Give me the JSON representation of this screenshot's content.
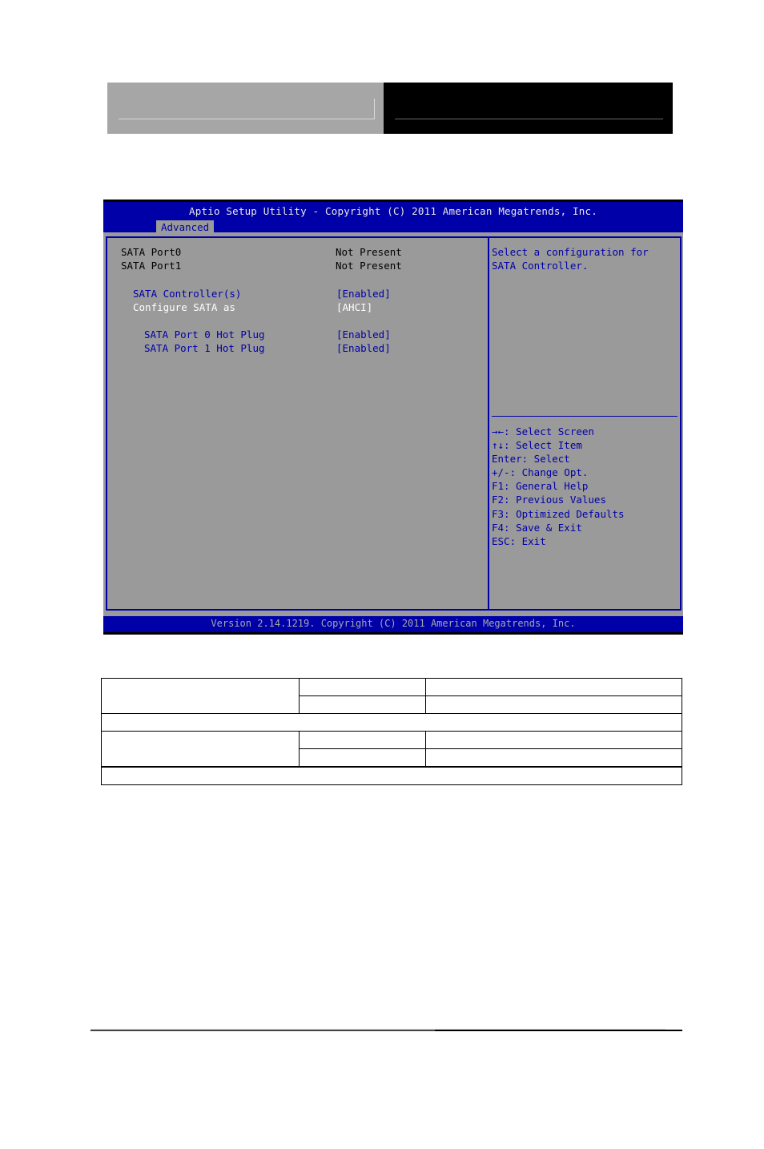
{
  "bios": {
    "title": "Aptio Setup Utility - Copyright (C) 2011 American Megatrends, Inc.",
    "active_tab": "Advanced",
    "footer": "Version 2.14.1219. Copyright (C) 2011 American Megatrends, Inc.",
    "items": [
      {
        "label": "SATA Port0",
        "value": "Not Present"
      },
      {
        "label": "SATA Port1",
        "value": "Not Present"
      },
      {
        "label": "SATA Controller(s)",
        "value": "[Enabled]"
      },
      {
        "label": "Configure SATA as",
        "value": "[AHCI]"
      },
      {
        "label": "SATA Port 0 Hot Plug",
        "value": "[Enabled]"
      },
      {
        "label": "SATA Port 1 Hot Plug",
        "value": "[Enabled]"
      }
    ],
    "help_text": [
      "Select a configuration for",
      "SATA Controller."
    ],
    "key_help": [
      "→←: Select Screen",
      "↑↓: Select Item",
      "Enter: Select",
      "+/-: Change Opt.",
      "F1: General Help",
      "F2: Previous Values",
      "F3: Optimized Defaults",
      "F4: Save & Exit",
      "ESC: Exit"
    ]
  },
  "colors": {
    "bios_blue": "#0000a8",
    "bios_gray": "#9a9a9a",
    "highlight_white": "#ffffff"
  }
}
